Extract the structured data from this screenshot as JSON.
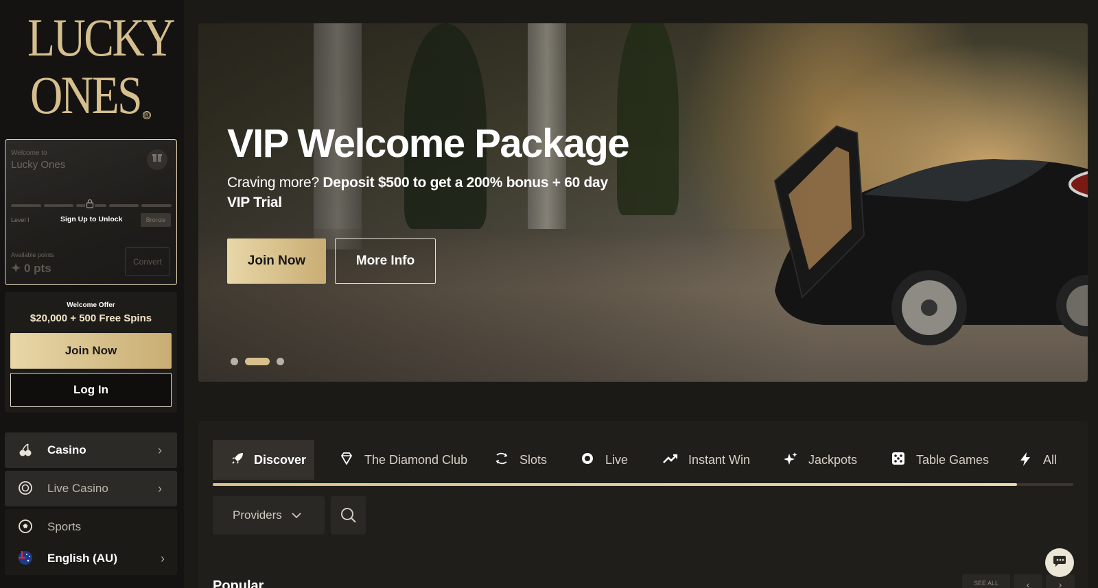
{
  "brand": {
    "logo_line1": "LUCKY",
    "logo_line2": "ONES",
    "registered": "®"
  },
  "vip_card": {
    "welcome_to": "Welcome to",
    "brand_name": "Lucky Ones",
    "level": "Level I",
    "unlock_label": "Sign Up to Unlock",
    "tier": "Bronze",
    "available_points_label": "Available points",
    "points_value": "0 pts",
    "convert_label": "Convert",
    "level_progress": 0
  },
  "offer": {
    "title": "Welcome Offer",
    "value": "$20,000 + 500 Free Spins",
    "join_label": "Join Now",
    "login_label": "Log In"
  },
  "nav": {
    "items": [
      {
        "label": "Casino",
        "icon": "cherries-icon",
        "chevron": true
      },
      {
        "label": "Live Casino",
        "icon": "chip-icon",
        "chevron": true
      },
      {
        "label": "Sports",
        "icon": "soccer-ball-icon",
        "chevron": false
      }
    ],
    "language": {
      "label": "English (AU)",
      "icon": "australia-flag-icon"
    }
  },
  "hero": {
    "title": "VIP Welcome Package",
    "subtitle_plain": "Craving more?",
    "subtitle_bold": "Deposit $500 to get a 200% bonus + 60 day VIP Trial",
    "join_label": "Join Now",
    "more_label": "More Info",
    "slides_total": 3,
    "active_slide": 2
  },
  "games": {
    "tabs": [
      {
        "label": "Discover",
        "icon": "rocket-icon",
        "active": true
      },
      {
        "label": "The Diamond Club",
        "icon": "diamond-icon",
        "active": false
      },
      {
        "label": "Slots",
        "icon": "slots-icon",
        "active": false
      },
      {
        "label": "Live",
        "icon": "live-chip-icon",
        "active": false
      },
      {
        "label": "Instant Win",
        "icon": "trend-up-icon",
        "active": false
      },
      {
        "label": "Jackpots",
        "icon": "sparkle-icon",
        "active": false
      },
      {
        "label": "Table Games",
        "icon": "dice-icon",
        "active": false
      },
      {
        "label": "All",
        "icon": "lightning-icon",
        "active": false
      }
    ],
    "providers_label": "Providers",
    "section_title": "Popular",
    "see_all_label": "SEE ALL"
  },
  "colors": {
    "gold": "#d8c08d",
    "background": "#1c1a17",
    "sidebar": "#141311"
  }
}
